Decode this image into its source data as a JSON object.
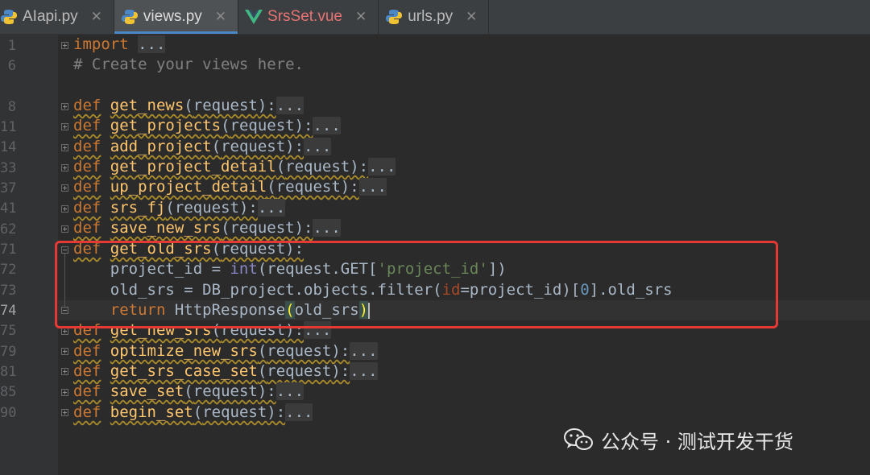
{
  "tabs": [
    {
      "label": "AIapi.py",
      "icon": "python-file-icon",
      "active": false
    },
    {
      "label": "views.py",
      "icon": "python-file-icon",
      "active": true
    },
    {
      "label": "SrsSet.vue",
      "icon": "vue-file-icon",
      "active": false
    },
    {
      "label": "urls.py",
      "icon": "python-file-icon",
      "active": false
    }
  ],
  "close_glyph": "✕",
  "line_numbers": [
    "1",
    "6",
    "",
    "8",
    "11",
    "14",
    "33",
    "37",
    "41",
    "62",
    "71",
    "72",
    "73",
    "74",
    "75",
    "79",
    "81",
    "85",
    "90"
  ],
  "code": {
    "import_kw": "import",
    "import_dots": "...",
    "comment": "# Create your views here.",
    "def_kw": "def",
    "return_kw": "return",
    "request_param": "request",
    "functions": [
      "get_news",
      "get_projects",
      "add_project",
      "get_project_detail",
      "up_project_detail",
      "srs_fj",
      "save_new_srs",
      "get_old_srs",
      "get_new_srs",
      "optimize_new_srs",
      "get_srs_case_set",
      "save_set",
      "begin_set"
    ],
    "line72": {
      "var": "project_id",
      "builtin": "int",
      "obj": "request.GET[",
      "key": "'project_id'",
      "end": "])"
    },
    "line73": {
      "var": "old_srs",
      "call": "DB_project.objects.filter(",
      "named_arg": "id",
      "arg": "=project_id)[",
      "index": "0",
      "end": "].old_srs"
    },
    "line74": {
      "call": "HttpResponse",
      "arg": "old_srs"
    }
  },
  "watermark": {
    "text": "公众号 · 测试开发干货",
    "icon": "wechat-icon"
  },
  "colors": {
    "highlight_box": "#e53935",
    "keyword": "#cc7832",
    "function": "#ffc66d",
    "string": "#6a8759"
  }
}
